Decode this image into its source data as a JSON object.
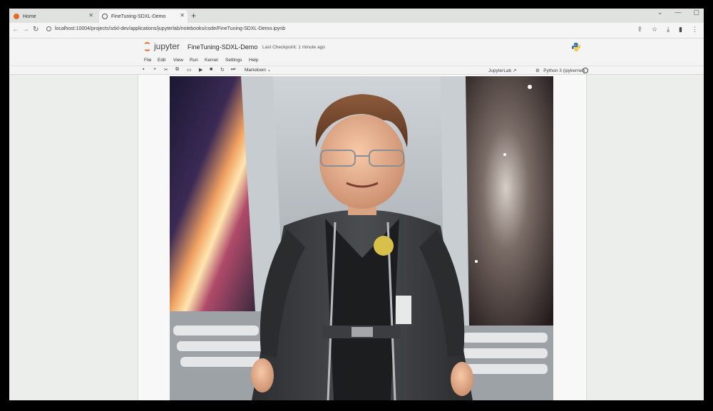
{
  "browser": {
    "tabs": [
      {
        "title": "Home"
      },
      {
        "title": "FineTuning-SDXL-Demo"
      }
    ],
    "new_tab_label": "+",
    "url": "localhost:10004/projects/sdxl-dev/applications/jupyterlab/notebooks/code/FineTuning-SDXL-Demo.ipynb"
  },
  "jupyter": {
    "logo_text": "jupyter",
    "notebook_title": "FineTuning-SDXL-Demo",
    "checkpoint": "Last Checkpoint: 1 minute ago",
    "menu": [
      "File",
      "Edit",
      "View",
      "Run",
      "Kernel",
      "Settings",
      "Help"
    ],
    "cell_type": "Markdown",
    "jupyterlab_link": "JupyterLab",
    "kernel_name": "Python 3 (ipykernel)"
  },
  "colors": {
    "accent": "#e8772e",
    "page_bg": "#eceeec"
  },
  "icons": {
    "toolbar": [
      "save-icon",
      "add-cell-icon",
      "cut-icon",
      "copy-icon",
      "paste-icon",
      "run-icon",
      "stop-icon",
      "restart-icon",
      "fast-forward-icon"
    ]
  }
}
